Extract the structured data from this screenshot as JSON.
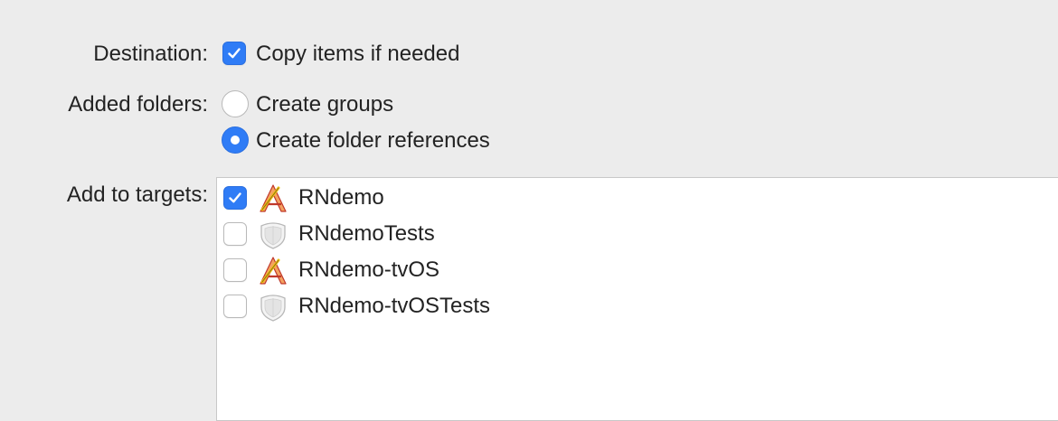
{
  "destination": {
    "label": "Destination:",
    "option_label": "Copy items if needed",
    "checked": true
  },
  "added_folders": {
    "label": "Added folders:",
    "options": [
      {
        "label": "Create groups",
        "selected": false
      },
      {
        "label": "Create folder references",
        "selected": true
      }
    ]
  },
  "targets": {
    "label": "Add to targets:",
    "items": [
      {
        "name": "RNdemo",
        "checked": true,
        "icon": "app-target-icon"
      },
      {
        "name": "RNdemoTests",
        "checked": false,
        "icon": "test-target-icon"
      },
      {
        "name": "RNdemo-tvOS",
        "checked": false,
        "icon": "app-target-icon"
      },
      {
        "name": "RNdemo-tvOSTests",
        "checked": false,
        "icon": "test-target-icon"
      }
    ]
  },
  "colors": {
    "accent": "#2f7cf6",
    "background": "#ececec"
  }
}
